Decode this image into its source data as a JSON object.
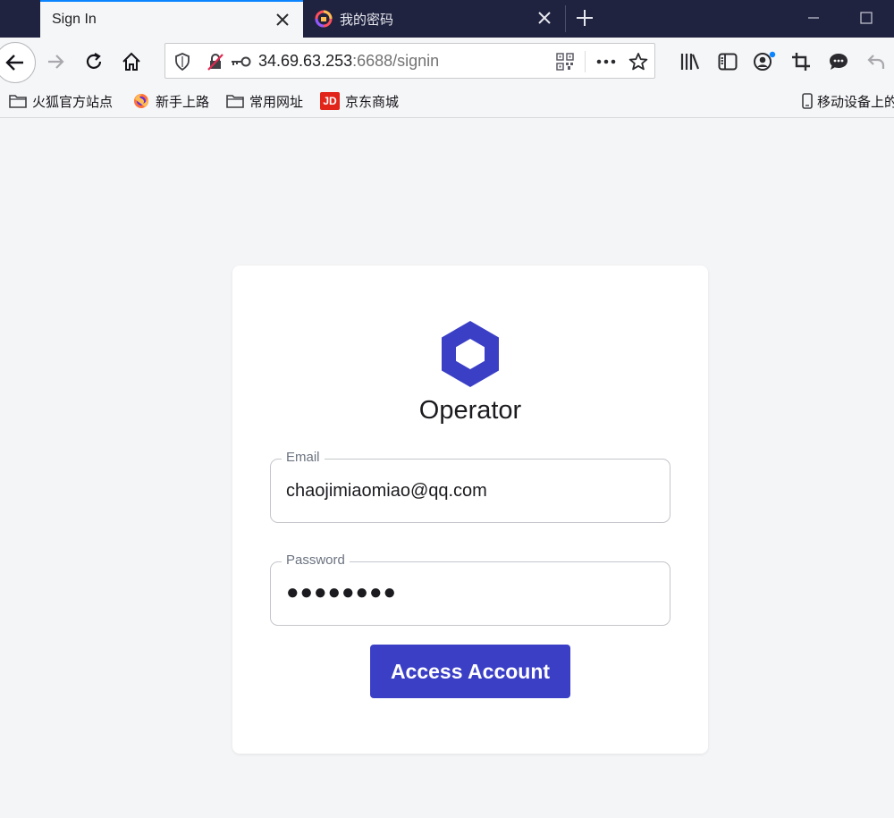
{
  "browser": {
    "tabs": [
      {
        "title": "Sign In",
        "active": true
      },
      {
        "title": "我的密码",
        "active": false
      }
    ],
    "url": {
      "host": "34.69.63.253",
      "rest": ":6688/signin"
    },
    "bookmarks": [
      {
        "label": "火狐官方站点",
        "icon": "folder-icon"
      },
      {
        "label": "新手上路",
        "icon": "firefox-icon"
      },
      {
        "label": "常用网址",
        "icon": "folder-icon"
      },
      {
        "label": "京东商城",
        "icon": "jd-icon",
        "icon_text": "JD"
      },
      {
        "label": "移动设备上的",
        "icon": "mobile-icon"
      }
    ]
  },
  "login": {
    "brand": "Operator",
    "email_label": "Email",
    "email_value": "chaojimiaomiao@qq.com",
    "password_label": "Password",
    "password_value": "●●●●●●●●",
    "submit_label": "Access Account"
  },
  "colors": {
    "accent": "#3b3fc6",
    "tabbar": "#202340",
    "page_bg": "#f4f5f7"
  }
}
